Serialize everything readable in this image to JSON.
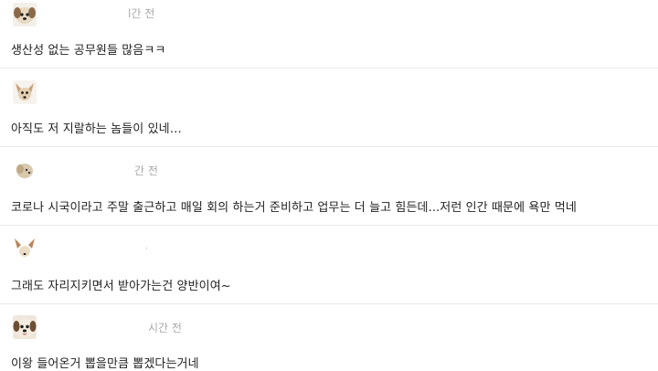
{
  "comments": [
    {
      "time": "l간 전",
      "text": "생산성 없는 공무원들 많음ㅋㅋ",
      "avatar": "dog-avatar-icon"
    },
    {
      "time": "",
      "text": "아직도 저 지랄하는 놈들이 있네…",
      "avatar": "dog-avatar-icon"
    },
    {
      "time": "간 전",
      "text": "코로나 시국이라고 주말 출근하고 매일 회의 하는거 준비하고 업무는 더 늘고 힘든데...저런 인간 때문에 욕만 먹네",
      "avatar": "dog-avatar-icon"
    },
    {
      "time": "ᆞ",
      "text": "그래도 자리지키면서 받아가는건 양반이여~",
      "avatar": "dog-avatar-icon"
    },
    {
      "time": "시간 전",
      "text": "이왕 들어온거 뽑을만큼 뽑겠다는거네",
      "avatar": "dog-avatar-icon"
    }
  ],
  "colors": {
    "divider": "#e8e8e8",
    "meta": "#a9a9a9",
    "text": "#222222"
  }
}
